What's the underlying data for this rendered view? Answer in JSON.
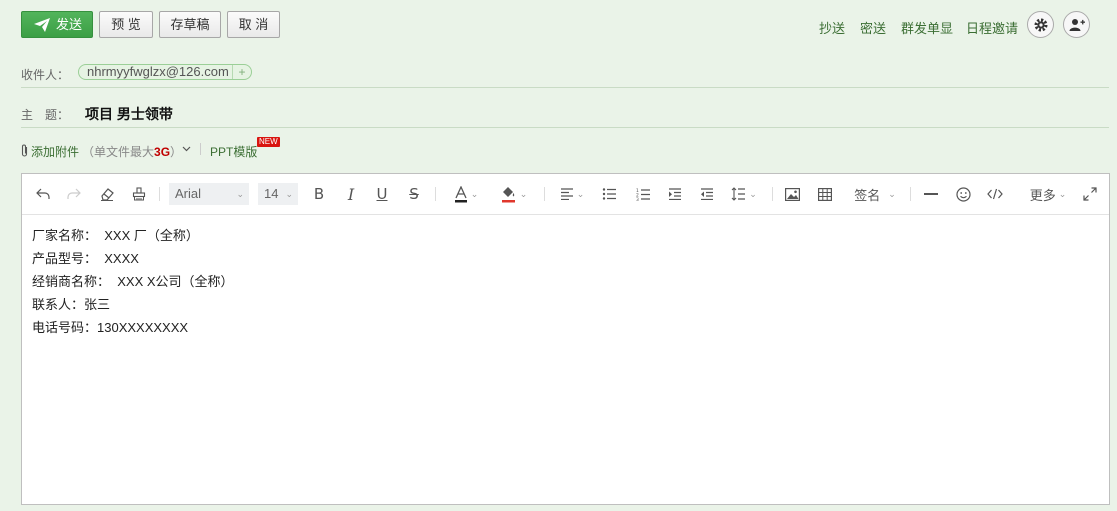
{
  "topbar": {
    "send_label": "发送",
    "preview_label": "预 览",
    "draft_label": "存草稿",
    "cancel_label": "取 消",
    "cc_label": "抄送",
    "bcc_label": "密送",
    "group_label": "群发单显",
    "schedule_label": "日程邀请"
  },
  "recipient": {
    "label": "收件人：",
    "email": "nhrmyyfwglzx@126.com",
    "add_symbol": "+"
  },
  "subject": {
    "label": "主　题：",
    "value": "项目 男士领带"
  },
  "attachment": {
    "label": "添加附件",
    "limit_prefix": "（单文件最大",
    "limit_value": "3G",
    "limit_suffix": "）",
    "ppt_label": "PPT模版",
    "new_badge": "NEW"
  },
  "toolbar": {
    "font_family": "Arial",
    "font_size": "14",
    "signature_label": "签名",
    "more_label": "更多"
  },
  "body": {
    "lines": [
      "厂家名称：  XXX 厂（全称）",
      "产品型号：  XXXX",
      "经销商名称：  XXX X公司（全称）",
      "联系人：张三",
      "电话号码：130XXXXXXXX"
    ]
  },
  "colors": {
    "page_bg": "#eaf3e8",
    "send_green": "#45a84e",
    "link_green": "#3b6e33",
    "attach_limit_red": "#c00000",
    "badge_red": "#d9140f"
  }
}
